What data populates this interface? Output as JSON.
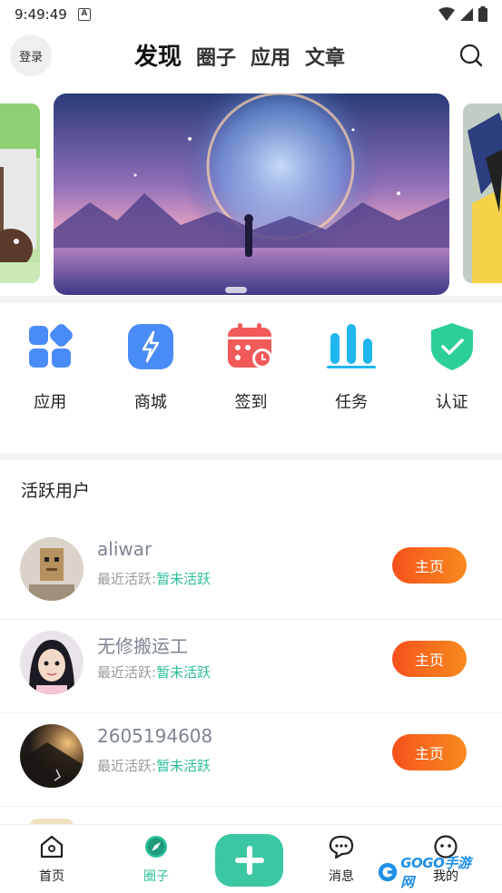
{
  "status_bar": {
    "time": "9:49:49",
    "notification_letter": "A"
  },
  "header": {
    "login_label": "登录",
    "tabs": [
      {
        "label": "发现",
        "active": true
      },
      {
        "label": "圈子",
        "active": false
      },
      {
        "label": "应用",
        "active": false
      },
      {
        "label": "文章",
        "active": false
      }
    ]
  },
  "quick_actions": [
    {
      "label": "应用",
      "icon": "apps-grid-icon"
    },
    {
      "label": "商城",
      "icon": "lightning-icon"
    },
    {
      "label": "签到",
      "icon": "calendar-check-icon"
    },
    {
      "label": "任务",
      "icon": "bar-chart-icon"
    },
    {
      "label": "认证",
      "icon": "shield-check-icon"
    }
  ],
  "active_users": {
    "title": "活跃用户",
    "users": [
      {
        "name": "aliwar",
        "status_label": "最近活跃:",
        "status_value": "暂未活跃",
        "button": "主页"
      },
      {
        "name": "无修搬运工",
        "status_label": "最近活跃:",
        "status_value": "暂未活跃",
        "button": "主页"
      },
      {
        "name": "2605194608",
        "status_label": "最近活跃:",
        "status_value": "暂未活跃",
        "button": "主页"
      }
    ]
  },
  "bottom_nav": {
    "items": [
      {
        "label": "首页",
        "icon": "home-icon",
        "active": false
      },
      {
        "label": "圈子",
        "icon": "compass-icon",
        "active": true
      },
      {
        "label": "消息",
        "icon": "chat-icon",
        "active": false
      },
      {
        "label": "我的",
        "icon": "profile-icon",
        "active": false
      }
    ]
  },
  "watermark": {
    "text": "GOGO手游网"
  },
  "colors": {
    "accent": "#3cc7a3",
    "button_orange": "#f6521c",
    "active_green": "#2bbf9a"
  }
}
